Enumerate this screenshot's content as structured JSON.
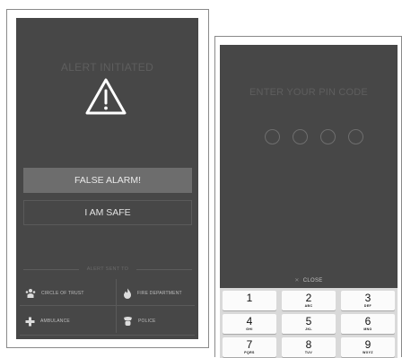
{
  "alert_screen": {
    "title": "ALERT INITIATED",
    "icon": "warning-triangle-icon",
    "false_alarm_label": "FALSE ALARM!",
    "safe_label": "I AM SAFE",
    "sent_to_label": "ALERT SENT TO",
    "contacts": [
      {
        "label": "CIRCLE OF TRUST",
        "icon": "people-icon"
      },
      {
        "label": "FIRE DEPARTMENT",
        "icon": "fire-icon"
      },
      {
        "label": "AMBULANCE",
        "icon": "medical-cross-icon"
      },
      {
        "label": "POLICE",
        "icon": "police-icon"
      }
    ]
  },
  "pin_screen": {
    "title": "ENTER YOUR PIN CODE",
    "pin_length": 4,
    "close_label": "CLOSE",
    "keys": [
      {
        "digit": "1",
        "letters": ""
      },
      {
        "digit": "2",
        "letters": "ABC"
      },
      {
        "digit": "3",
        "letters": "DEF"
      },
      {
        "digit": "4",
        "letters": "GHI"
      },
      {
        "digit": "5",
        "letters": "JKL"
      },
      {
        "digit": "6",
        "letters": "MNO"
      },
      {
        "digit": "7",
        "letters": "PQRS"
      },
      {
        "digit": "8",
        "letters": "TUV"
      },
      {
        "digit": "9",
        "letters": "WXYZ"
      }
    ]
  },
  "colors": {
    "screen_bg": "#474747",
    "faded_text": "#5e5e5e",
    "button_fill": "#6d6d6d",
    "keypad_bg": "#d9d9d9"
  }
}
